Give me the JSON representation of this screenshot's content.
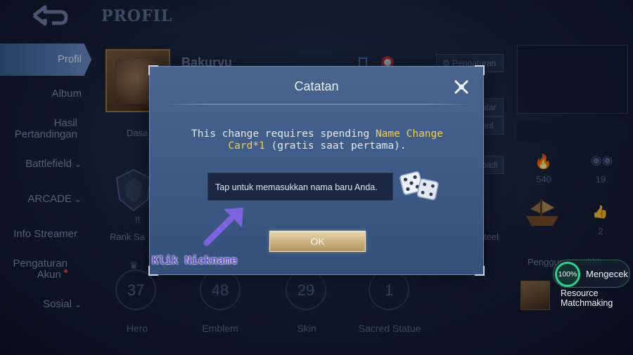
{
  "header": {
    "title": "PROFIL"
  },
  "sidebar": {
    "items": [
      {
        "label": "Profil"
      },
      {
        "label": "Album"
      },
      {
        "label": "Hasil Pertandingan"
      },
      {
        "label": "Battlefield"
      },
      {
        "label": "ARCADE"
      },
      {
        "label": "Info Streamer"
      },
      {
        "label": "Pengaturan Akun"
      },
      {
        "label": "Sosial"
      }
    ]
  },
  "profile": {
    "name": "Bakuryu",
    "avatar_caption": "Dasa",
    "rank_label": "Rank Sa",
    "rank_badge_text": "!!",
    "settings_button": "Pengaturan",
    "right_side_buttons": [
      "atar",
      "ent",
      "badi"
    ],
    "right_tag": "teel"
  },
  "stats": [
    {
      "value": "37",
      "label": "Hero"
    },
    {
      "value": "48",
      "label": "Emblem"
    },
    {
      "value": "29",
      "label": "Skin"
    },
    {
      "value": "1",
      "label": "Sacred Statue"
    }
  ],
  "side_stats": {
    "a": "540",
    "b": "19",
    "c": "2",
    "recent_label": "Pengguna terakhir"
  },
  "dialog": {
    "title": "Catatan",
    "message_prefix": "This change requires spending ",
    "message_highlight": "Name Change Card*1",
    "message_suffix": " (gratis saat pertama).",
    "input_placeholder": "Tap untuk memasukkan nama baru Anda.",
    "ok_label": "OK"
  },
  "annotation": {
    "text": "Klik Nickname",
    "color": "#6a4fd0"
  },
  "matchmaking": {
    "progress": "100%",
    "progress_value": 100,
    "status": "Mengecek",
    "label_line1": "Resource",
    "label_line2": "Matchmaking"
  },
  "colors": {
    "highlight": "#f1cf57",
    "ok_button": "#c9af7e",
    "progress_ring": "#33d08f"
  }
}
